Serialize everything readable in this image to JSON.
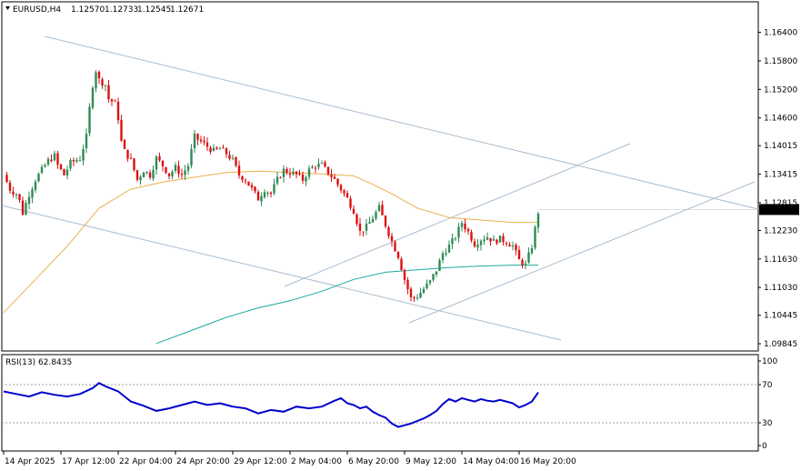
{
  "header": {
    "symbol": "EURUSD,H4",
    "open": "1.12570",
    "high": "1.12733",
    "low": "1.12545",
    "close": "1.12671"
  },
  "rsi_header": {
    "label": "RSI(13) 62.8435"
  },
  "colors": {
    "background": "#ffffff",
    "bull_candle": "#2e8b57",
    "bear_candle": "#dd1111",
    "ma_fast": "#e8b04c",
    "ma_slow": "#1ca8a0",
    "channel_lines": "#a9bdd0",
    "rsi_line": "#0000cc",
    "grid": "#c8c8c8",
    "price_tag_bg": "#000000",
    "price_tag_text": "#ffffff"
  },
  "chart_data": [
    {
      "type": "candlestick",
      "symbol": "EURUSD",
      "timeframe": "H4",
      "price_ticks": [
        "1.16400",
        "1.15800",
        "1.15200",
        "1.14600",
        "1.14015",
        "1.13415",
        "1.12815",
        "1.12230",
        "1.11630",
        "1.11030",
        "1.10445",
        "1.09845"
      ],
      "current_price": "1.12671",
      "ylim": [
        1.0975,
        1.1668
      ],
      "x_tick_labels": [
        "14 Apr 2025",
        "17 Apr 12:00",
        "22 Apr 04:00",
        "24 Apr 20:00",
        "29 Apr 12:00",
        "2 May 04:00",
        "6 May 20:00",
        "9 May 12:00",
        "14 May 04:00",
        "16 May 20:00"
      ],
      "close_path": [
        [
          0,
          1.134
        ],
        [
          2,
          1.131
        ],
        [
          4,
          1.13
        ],
        [
          5,
          1.1285
        ],
        [
          6,
          1.126
        ],
        [
          8,
          1.13
        ],
        [
          10,
          1.133
        ],
        [
          12,
          1.135
        ],
        [
          14,
          1.137
        ],
        [
          16,
          1.138
        ],
        [
          17,
          1.136
        ],
        [
          19,
          1.134
        ],
        [
          21,
          1.1365
        ],
        [
          24,
          1.1375
        ],
        [
          26,
          1.142
        ],
        [
          27,
          1.148
        ],
        [
          28,
          1.153
        ],
        [
          29,
          1.156
        ],
        [
          30,
          1.154
        ],
        [
          32,
          1.153
        ],
        [
          33,
          1.15
        ],
        [
          35,
          1.149
        ],
        [
          36,
          1.146
        ],
        [
          37,
          1.141
        ],
        [
          38,
          1.139
        ],
        [
          40,
          1.137
        ],
        [
          42,
          1.133
        ],
        [
          44,
          1.135
        ],
        [
          46,
          1.134
        ],
        [
          48,
          1.1375
        ],
        [
          50,
          1.136
        ],
        [
          52,
          1.134
        ],
        [
          54,
          1.1355
        ],
        [
          56,
          1.134
        ],
        [
          58,
          1.136
        ],
        [
          60,
          1.142
        ],
        [
          62,
          1.141
        ],
        [
          64,
          1.14
        ],
        [
          66,
          1.139
        ],
        [
          68,
          1.1395
        ],
        [
          70,
          1.1385
        ],
        [
          72,
          1.137
        ],
        [
          74,
          1.134
        ],
        [
          76,
          1.133
        ],
        [
          78,
          1.131
        ],
        [
          80,
          1.129
        ],
        [
          82,
          1.131
        ],
        [
          84,
          1.13
        ],
        [
          86,
          1.133
        ],
        [
          88,
          1.135
        ],
        [
          90,
          1.1345
        ],
        [
          92,
          1.134
        ],
        [
          94,
          1.133
        ],
        [
          96,
          1.135
        ],
        [
          98,
          1.136
        ],
        [
          100,
          1.136
        ],
        [
          102,
          1.1345
        ],
        [
          104,
          1.133
        ],
        [
          106,
          1.131
        ],
        [
          108,
          1.129
        ],
        [
          110,
          1.1265
        ],
        [
          112,
          1.122
        ],
        [
          114,
          1.123
        ],
        [
          116,
          1.125
        ],
        [
          118,
          1.127
        ],
        [
          120,
          1.1235
        ],
        [
          122,
          1.12
        ],
        [
          124,
          1.117
        ],
        [
          126,
          1.112
        ],
        [
          128,
          1.108
        ],
        [
          130,
          1.1085
        ],
        [
          132,
          1.11
        ],
        [
          134,
          1.1115
        ],
        [
          136,
          1.114
        ],
        [
          138,
          1.1175
        ],
        [
          140,
          1.119
        ],
        [
          142,
          1.121
        ],
        [
          144,
          1.124
        ],
        [
          146,
          1.122
        ],
        [
          148,
          1.1195
        ],
        [
          150,
          1.1205
        ],
        [
          152,
          1.121
        ],
        [
          154,
          1.12
        ],
        [
          156,
          1.1205
        ],
        [
          158,
          1.12
        ],
        [
          160,
          1.119
        ],
        [
          162,
          1.116
        ],
        [
          164,
          1.115
        ],
        [
          166,
          1.119
        ],
        [
          168,
          1.1262
        ]
      ],
      "ma_fast_path": [
        [
          0,
          1.105
        ],
        [
          10,
          1.112
        ],
        [
          20,
          1.119
        ],
        [
          30,
          1.127
        ],
        [
          40,
          1.131
        ],
        [
          50,
          1.1325
        ],
        [
          60,
          1.1335
        ],
        [
          70,
          1.1345
        ],
        [
          80,
          1.1348
        ],
        [
          90,
          1.1345
        ],
        [
          100,
          1.1342
        ],
        [
          110,
          1.1338
        ],
        [
          116,
          1.132
        ],
        [
          122,
          1.13
        ],
        [
          130,
          1.127
        ],
        [
          140,
          1.125
        ],
        [
          150,
          1.1245
        ],
        [
          160,
          1.124
        ],
        [
          168,
          1.124
        ]
      ],
      "ma_slow_path": [
        [
          48,
          1.0985
        ],
        [
          60,
          1.1015
        ],
        [
          70,
          1.104
        ],
        [
          80,
          1.106
        ],
        [
          90,
          1.1075
        ],
        [
          100,
          1.1095
        ],
        [
          110,
          1.112
        ],
        [
          120,
          1.1135
        ],
        [
          130,
          1.114
        ],
        [
          140,
          1.1145
        ],
        [
          150,
          1.1148
        ],
        [
          160,
          1.115
        ],
        [
          168,
          1.115
        ]
      ]
    },
    {
      "type": "line",
      "indicator": "RSI(13)",
      "current_value": 62.8435,
      "y_tick_labels": [
        "100",
        "70",
        "30",
        "0"
      ],
      "ylim": [
        0,
        100
      ],
      "levels": [
        70,
        30
      ],
      "rsi_path": [
        [
          0,
          64
        ],
        [
          4,
          61
        ],
        [
          8,
          58
        ],
        [
          12,
          63
        ],
        [
          16,
          60
        ],
        [
          20,
          58
        ],
        [
          24,
          61
        ],
        [
          28,
          68
        ],
        [
          30,
          74
        ],
        [
          32,
          70
        ],
        [
          36,
          64
        ],
        [
          40,
          52
        ],
        [
          44,
          47
        ],
        [
          48,
          41
        ],
        [
          52,
          44
        ],
        [
          56,
          48
        ],
        [
          60,
          52
        ],
        [
          64,
          48
        ],
        [
          68,
          50
        ],
        [
          72,
          46
        ],
        [
          76,
          44
        ],
        [
          80,
          38
        ],
        [
          84,
          42
        ],
        [
          88,
          40
        ],
        [
          92,
          46
        ],
        [
          96,
          44
        ],
        [
          100,
          46
        ],
        [
          104,
          53
        ],
        [
          106,
          56
        ],
        [
          108,
          50
        ],
        [
          110,
          48
        ],
        [
          112,
          44
        ],
        [
          114,
          46
        ],
        [
          116,
          40
        ],
        [
          118,
          36
        ],
        [
          120,
          33
        ],
        [
          122,
          26
        ],
        [
          124,
          22
        ],
        [
          126,
          24
        ],
        [
          128,
          26
        ],
        [
          130,
          29
        ],
        [
          132,
          32
        ],
        [
          134,
          36
        ],
        [
          136,
          41
        ],
        [
          138,
          49
        ],
        [
          140,
          55
        ],
        [
          142,
          52
        ],
        [
          144,
          56
        ],
        [
          146,
          54
        ],
        [
          148,
          52
        ],
        [
          150,
          55
        ],
        [
          152,
          53
        ],
        [
          154,
          52
        ],
        [
          156,
          54
        ],
        [
          158,
          52
        ],
        [
          160,
          50
        ],
        [
          162,
          45
        ],
        [
          164,
          48
        ],
        [
          166,
          52
        ],
        [
          168,
          62.8
        ]
      ]
    }
  ]
}
